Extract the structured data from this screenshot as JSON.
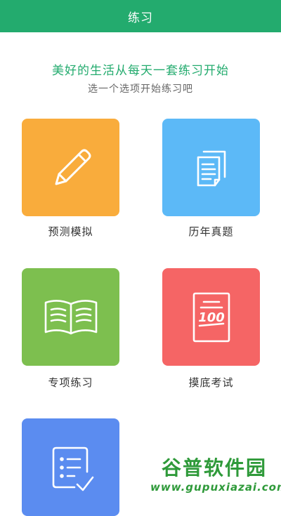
{
  "header": {
    "title": "练习"
  },
  "intro": {
    "slogan": "美好的生活从每天一套练习开始",
    "subtitle": "选一个选项开始练习吧"
  },
  "tiles": [
    {
      "label": "预测模拟",
      "color": "#f9ac3c",
      "icon": "pencil-icon"
    },
    {
      "label": "历年真题",
      "color": "#5cb9f7",
      "icon": "documents-icon"
    },
    {
      "label": "专项练习",
      "color": "#7dbf4f",
      "icon": "open-book-icon"
    },
    {
      "label": "摸底考试",
      "color": "#f56565",
      "icon": "exam-score-icon"
    },
    {
      "label": "",
      "color": "#5b8cf0",
      "icon": "checklist-icon"
    }
  ],
  "watermark": {
    "title": "谷普软件园",
    "url": "www.gupuxiazai.com"
  }
}
